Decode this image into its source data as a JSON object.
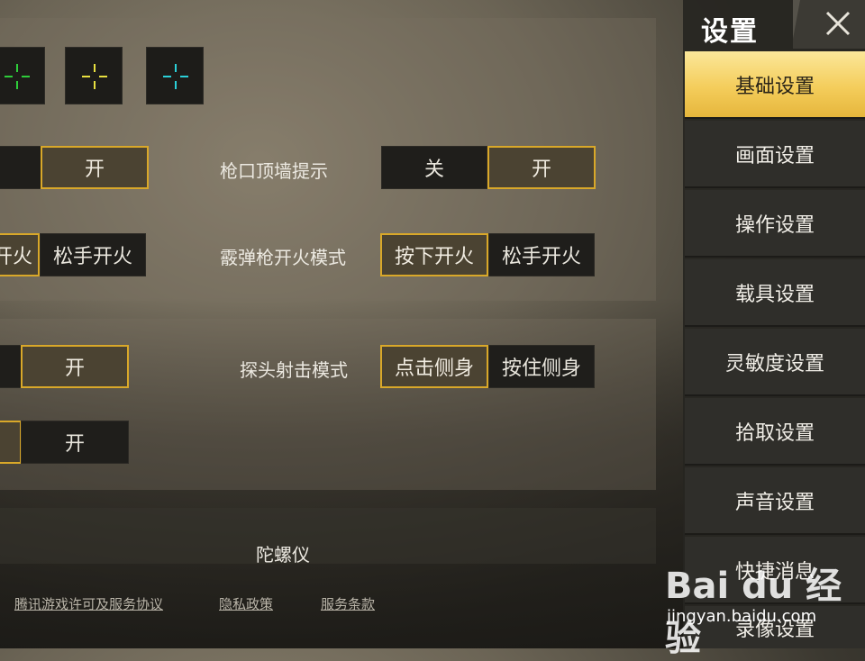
{
  "crosshairs": [
    {
      "name": "green",
      "color": "#2ecc3a"
    },
    {
      "name": "yellow",
      "color": "#e8e040"
    },
    {
      "name": "cyan",
      "color": "#2bd0d8"
    }
  ],
  "row1": {
    "left_off": "",
    "left_on": "开",
    "label": "枪口顶墙提示",
    "off": "关",
    "on": "开"
  },
  "row2": {
    "left_option1": "开火",
    "left_option2": "松手开火",
    "label": "霰弹枪开火模式",
    "option1": "按下开火",
    "option2": "松手开火"
  },
  "row3": {
    "left_off": "",
    "left_on": "开",
    "label": "探头射击模式",
    "option1": "点击侧身",
    "option2": "按住侧身"
  },
  "row4": {
    "left_on": "",
    "left_off": "开"
  },
  "gyro": {
    "label": "陀螺仪"
  },
  "footer_links": [
    "腾讯游戏许可及服务协议",
    "隐私政策",
    "服务条款"
  ],
  "sidebar": {
    "title": "设置",
    "items": [
      {
        "label": "基础设置",
        "active": true
      },
      {
        "label": "画面设置",
        "active": false
      },
      {
        "label": "操作设置",
        "active": false
      },
      {
        "label": "载具设置",
        "active": false
      },
      {
        "label": "灵敏度设置",
        "active": false
      },
      {
        "label": "拾取设置",
        "active": false
      },
      {
        "label": "声音设置",
        "active": false
      },
      {
        "label": "快捷消息",
        "active": false
      },
      {
        "label": "录像设置",
        "active": false
      }
    ]
  },
  "watermark": {
    "logo": "Bai du 经验",
    "url": "jingyan.baidu.com"
  },
  "colors": {
    "accent": "#d9a829",
    "active_tab": "#f4cd5b"
  }
}
